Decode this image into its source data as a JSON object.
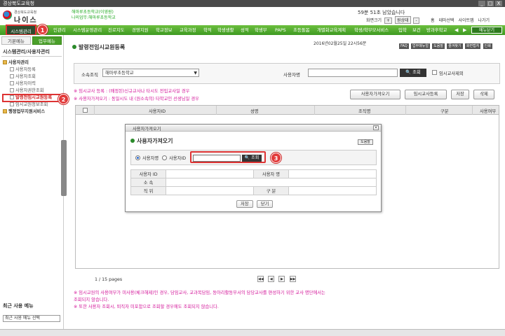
{
  "window": {
    "title": "경상북도교육청",
    "controls": [
      "_",
      "□",
      "X"
    ]
  },
  "header": {
    "org": "경상북도교육청",
    "logo_text": "나이스",
    "school_line1": "해마루초등학교(이영원)",
    "school_line2": "나의업무:해마루초등학교",
    "session": "59분 51초 남았습니다",
    "zoom_label": "화면크기",
    "zoom_plus": "+",
    "zoom_value": "원상태",
    "zoom_minus": "-",
    "links": [
      "홈",
      "테마선택",
      "사이트맵",
      "나가기"
    ]
  },
  "nav": {
    "selected": "시스템관리",
    "items": [
      "인관리",
      "시스템운영관리",
      "진로지도",
      "경영지원",
      "학교정보",
      "교육과정",
      "학적",
      "학생생활",
      "성적",
      "학생부",
      "PAPS",
      "초등돌봄",
      "개별화교육계획",
      "학생/학부모서비스",
      "입학",
      "보건",
      "방과후학교"
    ],
    "prev": "◀",
    "next": "▶",
    "menu_view": "메뉴닫기"
  },
  "sidebar": {
    "tabs": [
      "기본메뉴",
      "업무메뉴"
    ],
    "title": "시스템관리/사용자관리",
    "tree": [
      {
        "label": "사용자관리",
        "type": "folder"
      },
      {
        "label": "사용자등록",
        "type": "leaf"
      },
      {
        "label": "사용자조회",
        "type": "leaf"
      },
      {
        "label": "사용자이력",
        "type": "leaf"
      },
      {
        "label": "사용자권한조회",
        "type": "leaf"
      },
      {
        "label": "발령전임시교원등록",
        "type": "leaf"
      },
      {
        "label": "임시교원정보조회",
        "type": "leaf"
      },
      {
        "label": "행정업무지원서비스",
        "type": "folder"
      }
    ],
    "recent_title": "최근 사용 메뉴",
    "recent_select": "최근 사용 메뉴 선택"
  },
  "callouts": [
    "1",
    "2",
    "3"
  ],
  "page": {
    "title": "발령전임시교원등록",
    "date": "2016년02월25일 22시56분",
    "icons": [
      "FAQ",
      "업무매뉴얼",
      "도움말",
      "즐겨찾기",
      "화면캡처",
      "인쇄"
    ],
    "search": {
      "school_label": "소속조직",
      "school_value": "해마루초등학교",
      "user_label": "사용자명",
      "user_value": "",
      "search_button": "조회",
      "exclude_label": "임시교사제외"
    },
    "notes": [
      "※ 임시교사 등록 : (배정된)신규교사나 타시도 전입교사일 경우",
      "※ 사용자가져오기 : 동일시도 내 (원소속의) 타학교인 선생님일 경우"
    ],
    "actions": [
      "사용자가져오기",
      "임시교사등록",
      "저장",
      "삭제"
    ],
    "grid_headers": [
      "사용자ID",
      "성명",
      "조직명",
      "구분",
      "사용여부"
    ],
    "pager_text": "1 / 15 pages",
    "pager_buttons": [
      "◀◀",
      "◀",
      "▶",
      "▶▶"
    ],
    "bottom_notes": [
      "※ 임시교원의 사용여부가 미사용(체크해제)인 경우, 담임교사, 교과목담임, 동아리활동부서의 담당교사를 편성하기 위한 교사 명단에서는",
      "   조회되지 않습니다.",
      "※ 또한 사용자 조회시, 퇴직자 미포함으로 조회할 경우에도 조회되지 않습니다."
    ]
  },
  "dialog": {
    "window_title": "사용자가져오기",
    "title": "사용자가져오기",
    "help": "도움말",
    "radio_name": "사용자명",
    "radio_id": "사용자ID",
    "input_value": "",
    "search_button": "조회",
    "fields": {
      "user_id": "사용자 ID",
      "user_name": "사용자 명",
      "affiliation": "소 속",
      "position": "직 위",
      "category": "구 분"
    },
    "save": "저장",
    "close": "닫기"
  }
}
